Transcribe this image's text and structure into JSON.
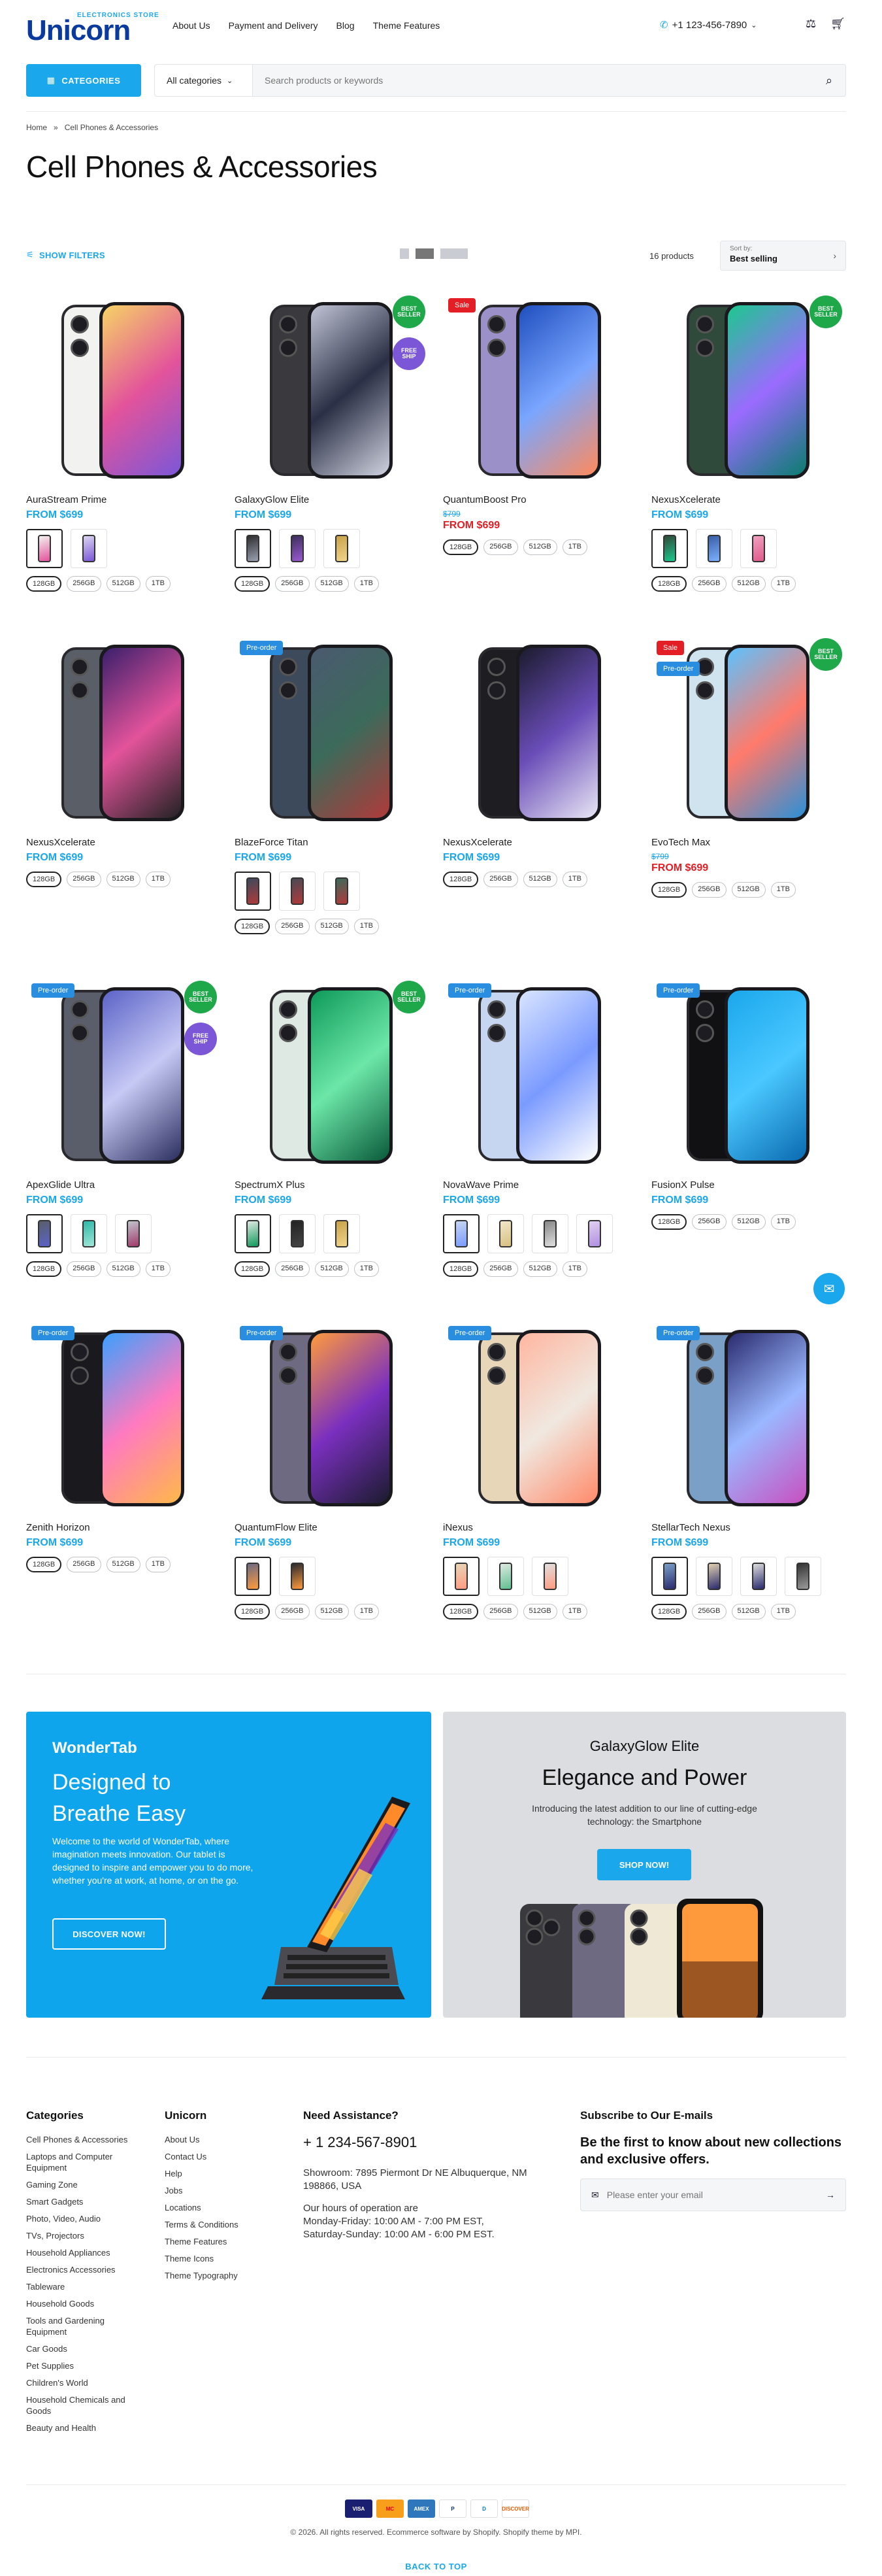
{
  "header": {
    "logo": "Unicorn",
    "logo_tag": "ELECTRONICS STORE",
    "nav": [
      "About Us",
      "Payment and Delivery",
      "Blog",
      "Theme Features"
    ],
    "phone": "+1 123-456-7890"
  },
  "search": {
    "categories_label": "CATEGORIES",
    "select_value": "All categories",
    "placeholder": "Search products or keywords"
  },
  "breadcrumb": [
    "Home",
    "»",
    "Cell Phones & Accessories"
  ],
  "page_title": "Cell Phones & Accessories",
  "toolbar": {
    "filters_label": "SHOW FILTERS",
    "count": "16 products",
    "sort_label": "Sort by:",
    "sort_value": "Best selling"
  },
  "products": [
    {
      "name": "AuraStream Prime",
      "price": "FROM $699",
      "old": "",
      "badge": "",
      "best": false,
      "free": false,
      "screen": [
        "#f6d365",
        "#e3539b",
        "#7b57d8"
      ],
      "body": "#f2f2f0",
      "swatches": [
        [
          "#f2f2f0",
          "#e3539b"
        ],
        [
          "#dcd6f0",
          "#7b57d8"
        ]
      ],
      "sizes": [
        "128GB",
        "256GB",
        "512GB",
        "1TB"
      ]
    },
    {
      "name": "GalaxyGlow Elite",
      "price": "FROM $699",
      "old": "",
      "badge": "",
      "best": true,
      "free": true,
      "screen": [
        "#bfc3d4",
        "#2b2f45",
        "#cfd3e0"
      ],
      "body": "#3a3a3e",
      "swatches": [
        [
          "#2e2e30",
          "#9aa0b0"
        ],
        [
          "#3d2f5f",
          "#9b59d0"
        ],
        [
          "#c8a24a",
          "#f0d58b"
        ]
      ],
      "sizes": [
        "128GB",
        "256GB",
        "512GB",
        "1TB"
      ]
    },
    {
      "name": "QuantumBoost Pro",
      "price": "FROM $699",
      "old": "$799",
      "badge": "Sale",
      "best": false,
      "free": false,
      "screen": [
        "#1f4fbf",
        "#7aa6ff",
        "#ff8a5c"
      ],
      "body": "#9b91c8",
      "swatches": [],
      "sizes": [
        "128GB",
        "256GB",
        "512GB",
        "1TB"
      ]
    },
    {
      "name": "NexusXcelerate",
      "price": "FROM $699",
      "old": "",
      "badge": "",
      "best": true,
      "free": false,
      "screen": [
        "#1bc98e",
        "#9a6bff",
        "#0a7d6f"
      ],
      "body": "#2f4a3a",
      "swatches": [
        [
          "#2f4a3a",
          "#1bc98e"
        ],
        [
          "#3b5ea8",
          "#7ab0ff"
        ],
        [
          "#f0a0c0",
          "#e05a8a"
        ]
      ],
      "sizes": [
        "128GB",
        "256GB",
        "512GB",
        "1TB"
      ]
    },
    {
      "name": "NexusXcelerate",
      "price": "FROM $699",
      "old": "",
      "badge": "",
      "best": false,
      "free": false,
      "screen": [
        "#3a1f6b",
        "#e3539b",
        "#222"
      ],
      "body": "#5a5e66",
      "swatches": [],
      "sizes": [
        "128GB",
        "256GB",
        "512GB",
        "1TB"
      ]
    },
    {
      "name": "BlazeForce Titan",
      "price": "FROM $699",
      "old": "",
      "badge": "Pre-order",
      "best": false,
      "free": false,
      "screen": [
        "#4a5a70",
        "#3c6a5a",
        "#b03a3a"
      ],
      "body": "#3d4a5c",
      "swatches": [
        [
          "#3d4a5c",
          "#b03a3a"
        ],
        [
          "#4a4a55",
          "#b03a3a"
        ],
        [
          "#3c6a5a",
          "#b03a3a"
        ]
      ],
      "sizes": [
        "128GB",
        "256GB",
        "512GB",
        "1TB"
      ]
    },
    {
      "name": "NexusXcelerate",
      "price": "FROM $699",
      "old": "",
      "badge": "",
      "best": false,
      "free": false,
      "screen": [
        "#1b1b2e",
        "#6a4db8",
        "#e8e6f5"
      ],
      "body": "#1e1e22",
      "swatches": [],
      "sizes": [
        "128GB",
        "256GB",
        "512GB",
        "1TB"
      ]
    },
    {
      "name": "EvoTech Max",
      "price": "FROM $699",
      "old": "$799",
      "badge": "Sale",
      "badge2": "Pre-order",
      "best": true,
      "free": false,
      "screen": [
        "#5cc2ff",
        "#ff7a6b",
        "#2a90d8"
      ],
      "body": "#cfe4ef",
      "swatches": [],
      "sizes": [
        "128GB",
        "256GB",
        "512GB",
        "1TB"
      ]
    },
    {
      "name": "ApexGlide Ultra",
      "price": "FROM $699",
      "old": "",
      "badge": "Pre-order",
      "best": true,
      "free": true,
      "screen": [
        "#5b63c7",
        "#c7c9f5",
        "#2b2f5e"
      ],
      "body": "#5a5e6a",
      "swatches": [
        [
          "#5a5e6a",
          "#5b63c7"
        ],
        [
          "#2fb8a8",
          "#a0e6d8"
        ],
        [
          "#c0c4cc",
          "#a03a6a"
        ]
      ],
      "sizes": [
        "128GB",
        "256GB",
        "512GB",
        "1TB"
      ]
    },
    {
      "name": "SpectrumX Plus",
      "price": "FROM $699",
      "old": "",
      "badge": "",
      "best": true,
      "free": false,
      "screen": [
        "#0e9a5a",
        "#6ce7a8",
        "#0a5a3a"
      ],
      "body": "#dfe9e3",
      "swatches": [
        [
          "#dfe9e3",
          "#0e9a5a"
        ],
        [
          "#222",
          "#444"
        ],
        [
          "#c8a24a",
          "#f0d58b"
        ]
      ],
      "sizes": [
        "128GB",
        "256GB",
        "512GB",
        "1TB"
      ]
    },
    {
      "name": "NovaWave Prime",
      "price": "FROM $699",
      "old": "",
      "badge": "Pre-order",
      "best": false,
      "free": false,
      "screen": [
        "#d8e4ff",
        "#7a9aff",
        "#ffffff"
      ],
      "body": "#c7d6f0",
      "swatches": [
        [
          "#c7d6f0",
          "#7a9aff"
        ],
        [
          "#f0e6c8",
          "#d8c080"
        ],
        [
          "#888",
          "#ddd"
        ],
        [
          "#e0d0f0",
          "#b090e0"
        ]
      ],
      "sizes": [
        "128GB",
        "256GB",
        "512GB",
        "1TB"
      ]
    },
    {
      "name": "FusionX Pulse",
      "price": "FROM $699",
      "old": "",
      "badge": "Pre-order",
      "best": false,
      "free": false,
      "screen": [
        "#1aa7ec",
        "#4ac8ff",
        "#0a6ab0"
      ],
      "body": "#111114",
      "swatches": [],
      "sizes": [
        "128GB",
        "256GB",
        "512GB",
        "1TB"
      ]
    },
    {
      "name": "Zenith Horizon",
      "price": "FROM $699",
      "old": "",
      "badge": "Pre-order",
      "best": false,
      "free": false,
      "screen": [
        "#3aa0ff",
        "#ff7ac0",
        "#ffb84a"
      ],
      "body": "#1a1a1e",
      "swatches": [],
      "sizes": [
        "128GB",
        "256GB",
        "512GB",
        "1TB"
      ]
    },
    {
      "name": "QuantumFlow Elite",
      "price": "FROM $699",
      "old": "",
      "badge": "Pre-order",
      "best": false,
      "free": false,
      "screen": [
        "#ff9a3c",
        "#7a2fbf",
        "#1b1b2e"
      ],
      "body": "#6e6a82",
      "swatches": [
        [
          "#6e6a82",
          "#ff9a3c"
        ],
        [
          "#2a2a2e",
          "#ff9a3c"
        ]
      ],
      "sizes": [
        "128GB",
        "256GB",
        "512GB",
        "1TB"
      ]
    },
    {
      "name": "iNexus",
      "price": "FROM $699",
      "old": "",
      "badge": "Pre-order",
      "best": false,
      "free": false,
      "screen": [
        "#ffb6a0",
        "#f0e8e0",
        "#ff8a6a"
      ],
      "body": "#e8d6b8",
      "swatches": [
        [
          "#e8d6b8",
          "#ff9a80"
        ],
        [
          "#dfe9e3",
          "#60c090"
        ],
        [
          "#e0e0e0",
          "#ff9a80"
        ]
      ],
      "sizes": [
        "128GB",
        "256GB",
        "512GB",
        "1TB"
      ]
    },
    {
      "name": "StellarTech Nexus",
      "price": "FROM $699",
      "old": "",
      "badge": "Pre-order",
      "best": false,
      "free": false,
      "screen": [
        "#2a2a6e",
        "#9ab8ff",
        "#c850c0"
      ],
      "body": "#7aa0c8",
      "swatches": [
        [
          "#7aa0c8",
          "#2a2a6e"
        ],
        [
          "#e0d0b0",
          "#2a2a6e"
        ],
        [
          "#ddd",
          "#2a2a6e"
        ],
        [
          "#333",
          "#9a9a9a"
        ]
      ],
      "sizes": [
        "128GB",
        "256GB",
        "512GB",
        "1TB"
      ]
    }
  ],
  "banner_left": {
    "brand": "WonderTab",
    "title": "Designed to Breathe Easy",
    "text": "Welcome to the world of WonderTab, where imagination meets innovation. Our tablet is designed to inspire and empower you to do more, whether you're at work, at home, or on the go.",
    "button": "DISCOVER NOW!"
  },
  "banner_right": {
    "brand": "GalaxyGlow Elite",
    "title": "Elegance and Power",
    "text": "Introducing the latest addition to our line of cutting-edge technology: the Smartphone",
    "button": "SHOP NOW!"
  },
  "footer": {
    "categories_title": "Categories",
    "categories": [
      "Cell Phones & Accessories",
      "Laptops and Computer Equipment",
      "Gaming Zone",
      "Smart Gadgets",
      "Photo, Video, Audio",
      "TVs, Projectors",
      "Household Appliances",
      "Electronics Accessories",
      "Tableware",
      "Household Goods",
      "Tools and Gardening Equipment",
      "Car Goods",
      "Pet Supplies",
      "Children's World",
      "Household Chemicals and Goods",
      "Beauty and Health"
    ],
    "unicorn_title": "Unicorn",
    "unicorn_links": [
      "About Us",
      "Contact Us",
      "Help",
      "Jobs",
      "Locations",
      "Terms & Conditions",
      "Theme Features",
      "Theme Icons",
      "Theme Typography"
    ],
    "assist_title": "Need Assistance?",
    "assist_phone": "+ 1 234-567-8901",
    "showroom": "Showroom: 7895 Piermont Dr NE Albuquerque, NM 198866, USA",
    "hours_title": "Our hours of operation are",
    "hours_1": "Monday-Friday: 10:00 AM - 7:00 PM EST,",
    "hours_2": "Saturday-Sunday: 10:00 AM - 6:00 PM EST.",
    "subscribe_title": "Subscribe to Our E-mails",
    "subscribe_text": "Be the first to know about new collections and exclusive offers.",
    "email_placeholder": "Please enter your email",
    "payments": [
      "VISA",
      "MC",
      "AMEX",
      "P",
      "D",
      "DISCOVER"
    ],
    "copyright": "© 2026. All rights reserved. Ecommerce software by Shopify. Shopify theme by MPI.",
    "back_to_top": "BACK TO TOP"
  },
  "colors": {
    "accent": "#1aa7ec",
    "sale": "#e31e24",
    "best": "#1fa84a",
    "free": "#7b57d8",
    "logo": "#0b3a9e"
  }
}
